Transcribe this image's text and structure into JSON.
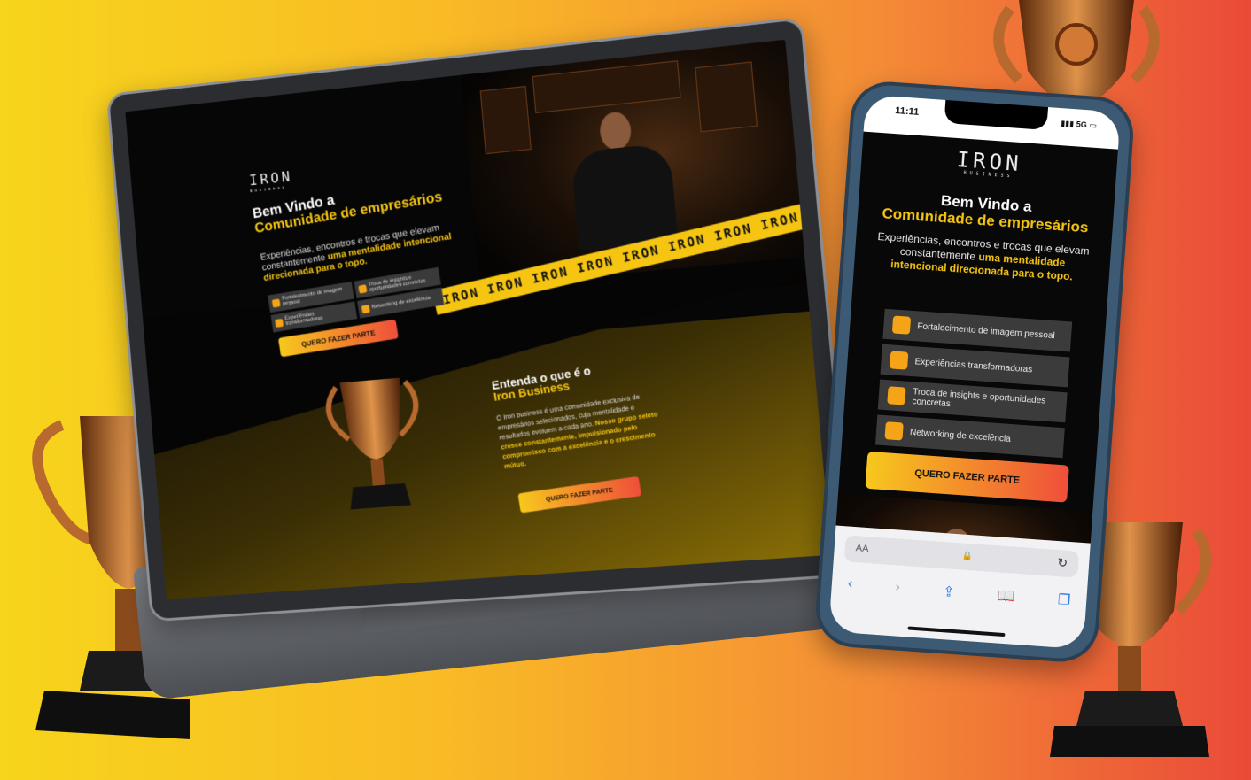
{
  "brand": {
    "logo": "IRON",
    "logo_sub": "BUSINESS"
  },
  "hero": {
    "title_line1": "Bem Vindo a",
    "title_line2": "Comunidade de empresários",
    "intro_plain": "Experiências, encontros e trocas que elevam constantemente",
    "intro_highlight": "uma mentalidade intencional direcionada para o topo."
  },
  "features": [
    {
      "label": "Fortalecimento de imagem pessoal",
      "icon": "rocket-icon"
    },
    {
      "label": "Troca de insights e oportunidades concretas",
      "icon": "brain-icon"
    },
    {
      "label": "Experiências transformadoras",
      "icon": "mountain-climb-icon"
    },
    {
      "label": "Networking de excelência",
      "icon": "handshake-icon"
    }
  ],
  "phone_features": [
    {
      "label": "Fortalecimento de imagem pessoal",
      "icon": "rocket-icon"
    },
    {
      "label": "Experiências transformadoras",
      "icon": "mountain-climb-icon"
    },
    {
      "label": "Troca de insights e oportunidades concretas",
      "icon": "brain-icon"
    },
    {
      "label": "Networking de excelência",
      "icon": "handshake-icon"
    }
  ],
  "cta_label": "QUERO FAZER PARTE",
  "about": {
    "title_line1": "Entenda o que é o",
    "title_line2": "Iron Business",
    "text_plain": "O Iron business é uma comunidade exclusiva de empresários selecionados, cuja mentalidade e resultados evoluem a cada ano.",
    "text_highlight": "Nosso grupo seleto cresce constantemente, impulsionado pelo compromisso com a excelência e o crescimento mútuo."
  },
  "ribbon_text": "IRON",
  "phone": {
    "time": "11:11",
    "signal": "5G",
    "browser_aa": "AA"
  },
  "colors": {
    "accent": "#f5c512",
    "cta_start": "#f7c81d",
    "cta_end": "#ef4f3a",
    "dark": "#050505"
  }
}
